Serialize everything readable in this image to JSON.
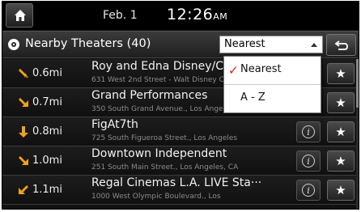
{
  "status": {
    "date": "Feb.  1",
    "time": "12:26",
    "ampm": "AM"
  },
  "header": {
    "title": "Nearby Theaters (40)",
    "sort_value": "Nearest",
    "back_icon": "back-arrow-icon"
  },
  "theaters": [
    {
      "distance": "0.6mi",
      "direction": "southeast",
      "name": "Roy and Edna Disney/Ca",
      "address": "631 West 2nd Street - Walt Disney Concert Hall"
    },
    {
      "distance": "0.7mi",
      "direction": "southeast",
      "name": "Grand Performances",
      "address": "350 South Grand Avenue., Los Angeles"
    },
    {
      "distance": "0.8mi",
      "direction": "south",
      "name": "FigAt7th",
      "address": "725 South Figueroa Street., Los Angeles"
    },
    {
      "distance": "1.0mi",
      "direction": "southeast",
      "name": "Downtown Independent",
      "address": "251 South Main Street., Los Angeles, CA"
    },
    {
      "distance": "1.1mi",
      "direction": "southwest",
      "name": "Regal Cinemas L.A. LIVE Sta···",
      "address": "1000 West Olympic Boulevard., Los"
    }
  ],
  "dropdown": {
    "options": [
      "Nearest",
      "A - Z"
    ],
    "selected": "Nearest"
  },
  "colors": {
    "direction_arrow": "#f0a020",
    "check": "#d01c1c"
  }
}
